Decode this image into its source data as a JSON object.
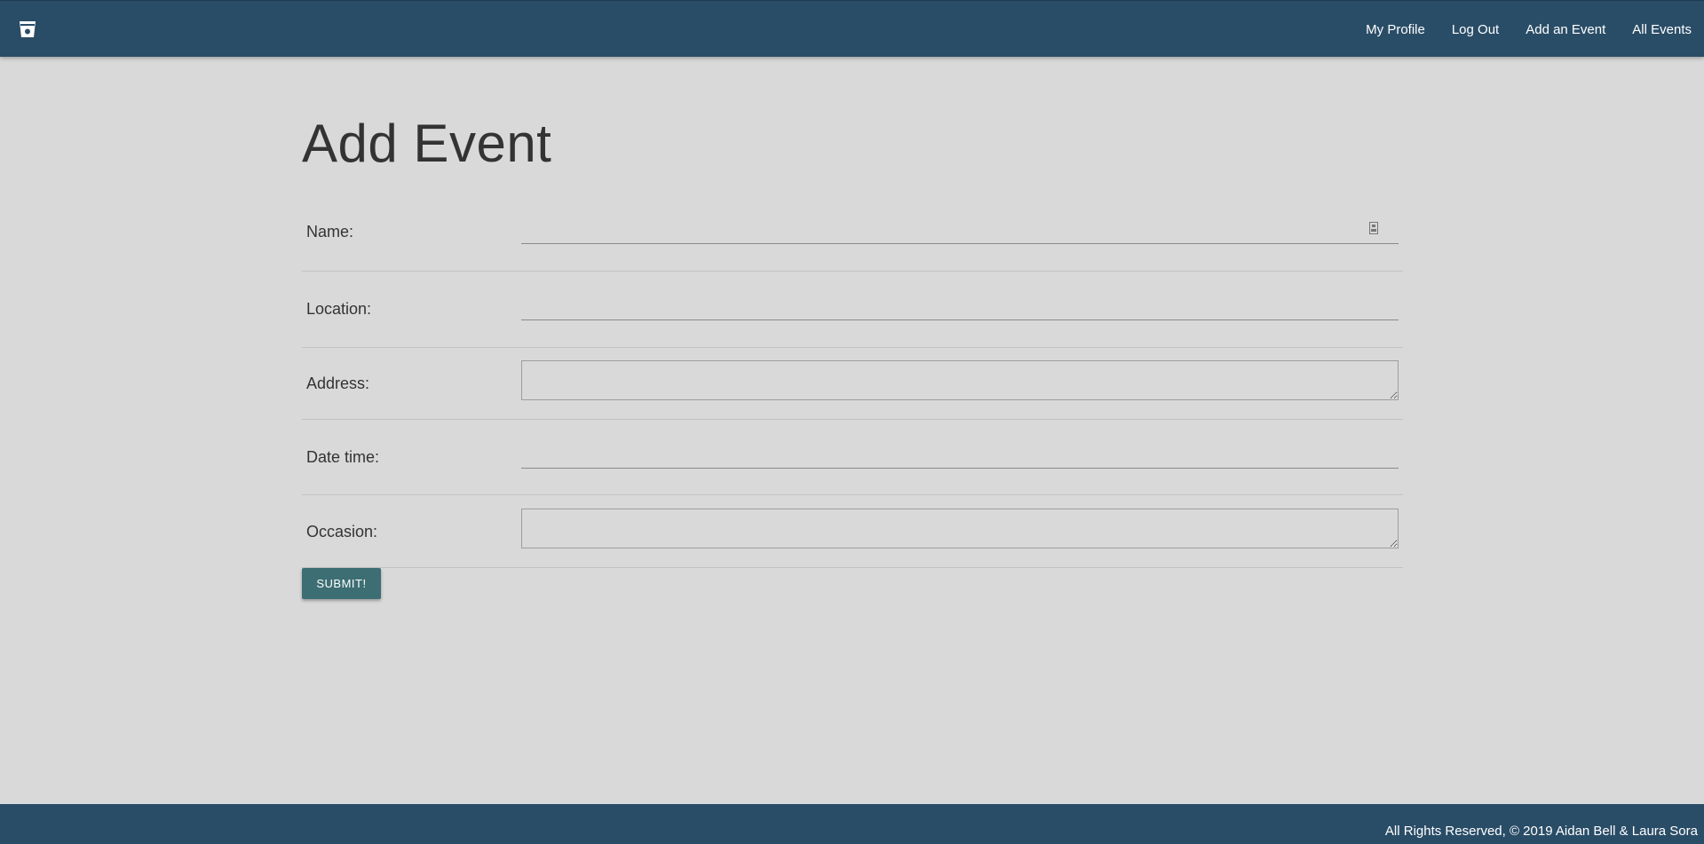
{
  "nav": {
    "brand_icon": "drink-cup-icon",
    "links": [
      "My Profile",
      "Log Out",
      "Add an Event",
      "All Events"
    ]
  },
  "page": {
    "title": "Add Event"
  },
  "form": {
    "fields": [
      {
        "label": "Name:",
        "type": "text",
        "value": ""
      },
      {
        "label": "Location:",
        "type": "text",
        "value": ""
      },
      {
        "label": "Address:",
        "type": "textarea",
        "value": ""
      },
      {
        "label": "Date time:",
        "type": "text",
        "value": ""
      },
      {
        "label": "Occasion:",
        "type": "textarea",
        "value": ""
      }
    ],
    "submit_label": "SUBMIT!"
  },
  "footer": {
    "text": "All Rights Reserved, © 2019 Aidan Bell & Laura Sora"
  },
  "colors": {
    "navbar": "#2a4d67",
    "background": "#d9d9d9",
    "button": "#3c6e73"
  }
}
